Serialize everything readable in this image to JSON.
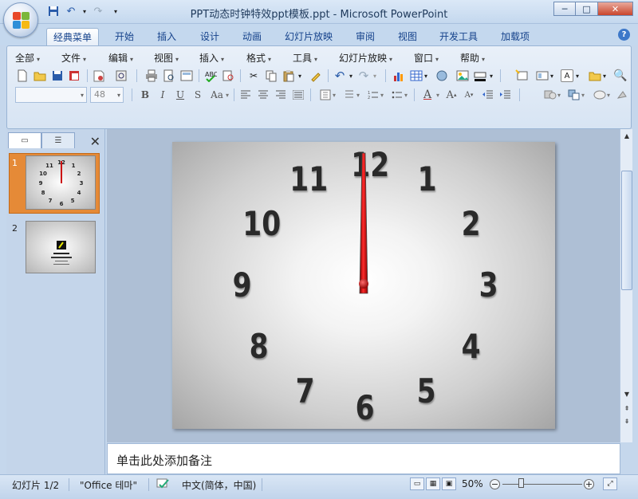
{
  "window": {
    "title": "PPT动态时钟特效ppt模板.ppt - Microsoft PowerPoint",
    "minimize": "─",
    "maximize": "□",
    "close": "✕"
  },
  "ribbon_tabs": [
    "经典菜单",
    "开始",
    "插入",
    "设计",
    "动画",
    "幻灯片放映",
    "审阅",
    "视图",
    "开发工具",
    "加载项"
  ],
  "menu": [
    "全部",
    "文件",
    "编辑",
    "视图",
    "插入",
    "格式",
    "工具",
    "幻灯片放映",
    "窗口",
    "帮助"
  ],
  "font_size": "48",
  "slides_pane": {
    "slide_numbers": [
      "1",
      "2"
    ]
  },
  "clock": {
    "numbers": [
      "12",
      "1",
      "2",
      "3",
      "4",
      "5",
      "6",
      "7",
      "8",
      "9",
      "10",
      "11"
    ],
    "hand_color": "#cc1111"
  },
  "notes": {
    "placeholder": "单击此处添加备注"
  },
  "status": {
    "slide": "幻灯片 1/2",
    "theme": "\"Office 테마\"",
    "language": "中文(简体，中国)",
    "zoom": "50%"
  }
}
